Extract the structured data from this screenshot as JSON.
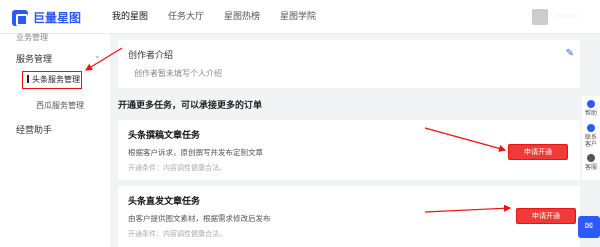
{
  "app": {
    "title": "巨量星图"
  },
  "nav": {
    "items": [
      "我的星图",
      "任务大厅",
      "星图热榜",
      "星图学院"
    ]
  },
  "user": {
    "name": "·········"
  },
  "sidebar": {
    "top_item": "业务管理",
    "group": "服务管理",
    "sub_item_active": "头条服务管理",
    "sub_item_2": "西瓜服务管理",
    "item_3": "经营助手"
  },
  "intro": {
    "title": "创作者介绍",
    "text": "创作者暂未填写个人介绍"
  },
  "section": {
    "title": "开通更多任务，可以承接更多的订单"
  },
  "tasks": [
    {
      "title": "头条撰稿文章任务",
      "desc": "根据客户诉求，原创撰写并发布定制文章",
      "cond": "开通条件：内容调性健康合法。",
      "button": "申请开通"
    },
    {
      "title": "头条直发文章任务",
      "desc": "由客户提供图文素材，根据需求修改后发布",
      "cond": "开通条件：内容调性健康合法。",
      "button": "申请开通"
    }
  ],
  "rightbar": {
    "help": "帮助",
    "contact": "联系客户",
    "service": "客服"
  },
  "colors": {
    "brand": "#2b5af6",
    "accent_red": "#e11111",
    "button_red": "#f03a3a"
  }
}
